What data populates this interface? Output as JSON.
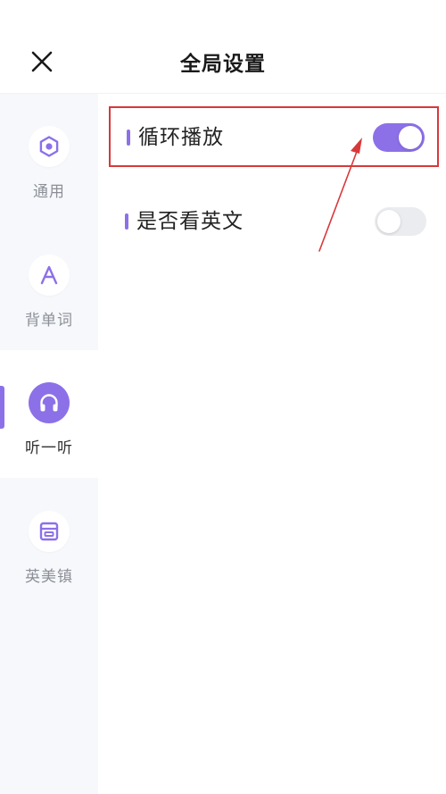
{
  "header": {
    "title": "全局设置",
    "close_icon": "close-icon"
  },
  "sidebar": {
    "items": [
      {
        "label": "通用",
        "icon": "hexagon-settings-icon",
        "active": false
      },
      {
        "label": "背单词",
        "icon": "letter-a-icon",
        "active": false
      },
      {
        "label": "听一听",
        "icon": "headphones-icon",
        "active": true
      },
      {
        "label": "英美镇",
        "icon": "building-icon",
        "active": false
      }
    ]
  },
  "settings": {
    "items": [
      {
        "label": "循环播放",
        "enabled": true,
        "highlighted": true
      },
      {
        "label": "是否看英文",
        "enabled": false,
        "highlighted": false
      }
    ]
  },
  "colors": {
    "accent": "#8c70e8",
    "highlight_border": "#d9383a",
    "annotation_arrow": "#d9383a",
    "toggle_off": "#ebecef",
    "sidebar_bg": "#f6f8fb"
  }
}
